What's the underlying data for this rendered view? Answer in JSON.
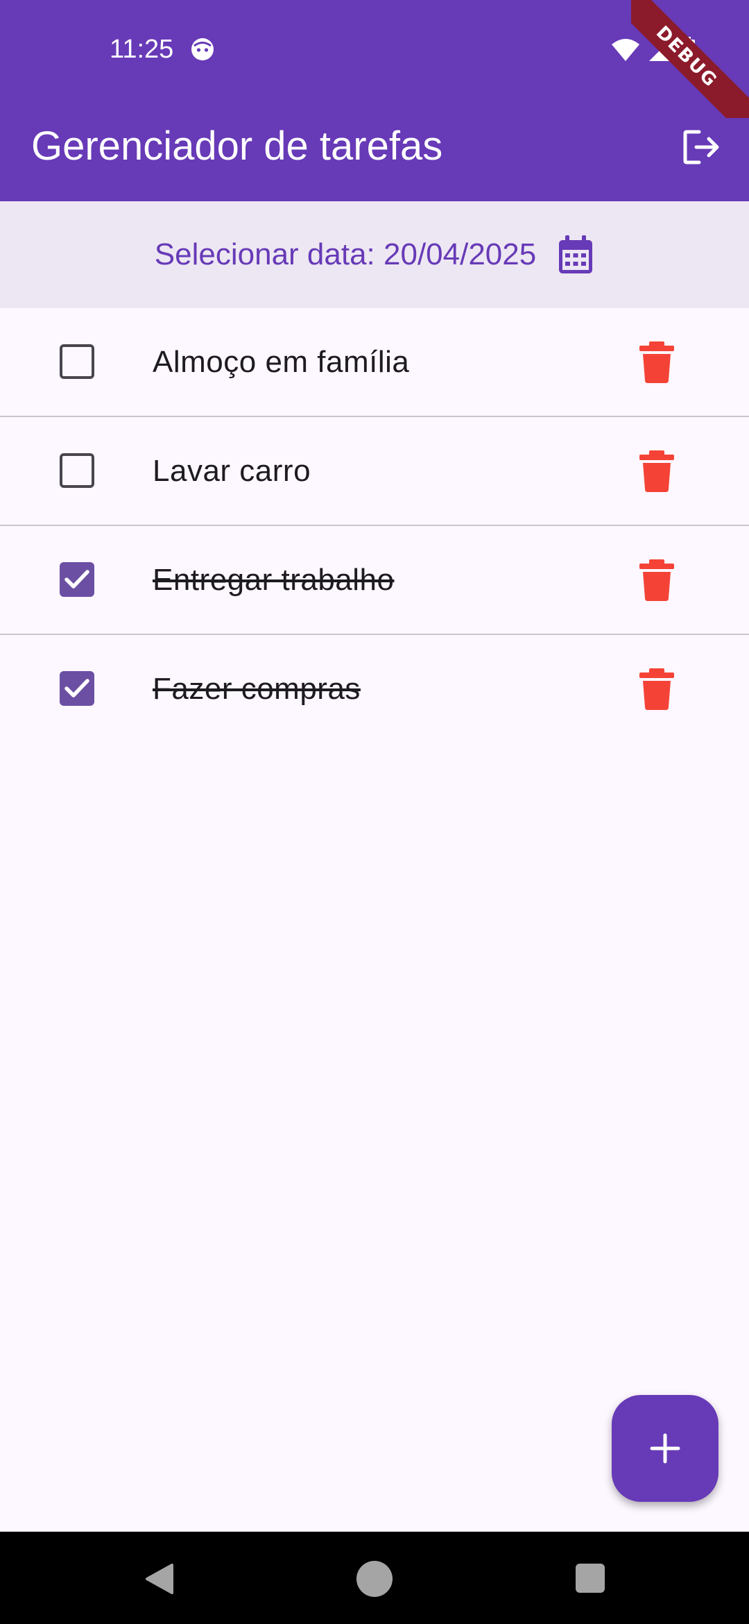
{
  "status_bar": {
    "time": "11:25"
  },
  "debug_banner": "DEBUG",
  "app_bar": {
    "title": "Gerenciador de tarefas",
    "logout_icon": "logout-icon"
  },
  "date_selector": {
    "label": "Selecionar data: 20/04/2025",
    "icon": "calendar-icon"
  },
  "tasks": [
    {
      "title": "Almoço em família",
      "done": false
    },
    {
      "title": "Lavar carro",
      "done": false
    },
    {
      "title": "Entregar trabalho",
      "done": true
    },
    {
      "title": "Fazer compras",
      "done": true
    }
  ],
  "fab": {
    "icon": "add-icon"
  },
  "colors": {
    "primary": "#673ab7",
    "date_bar": "#ede7f3",
    "checkbox_checked": "#6b4fa3",
    "delete": "#f44336",
    "background": "#fdf7ff"
  }
}
